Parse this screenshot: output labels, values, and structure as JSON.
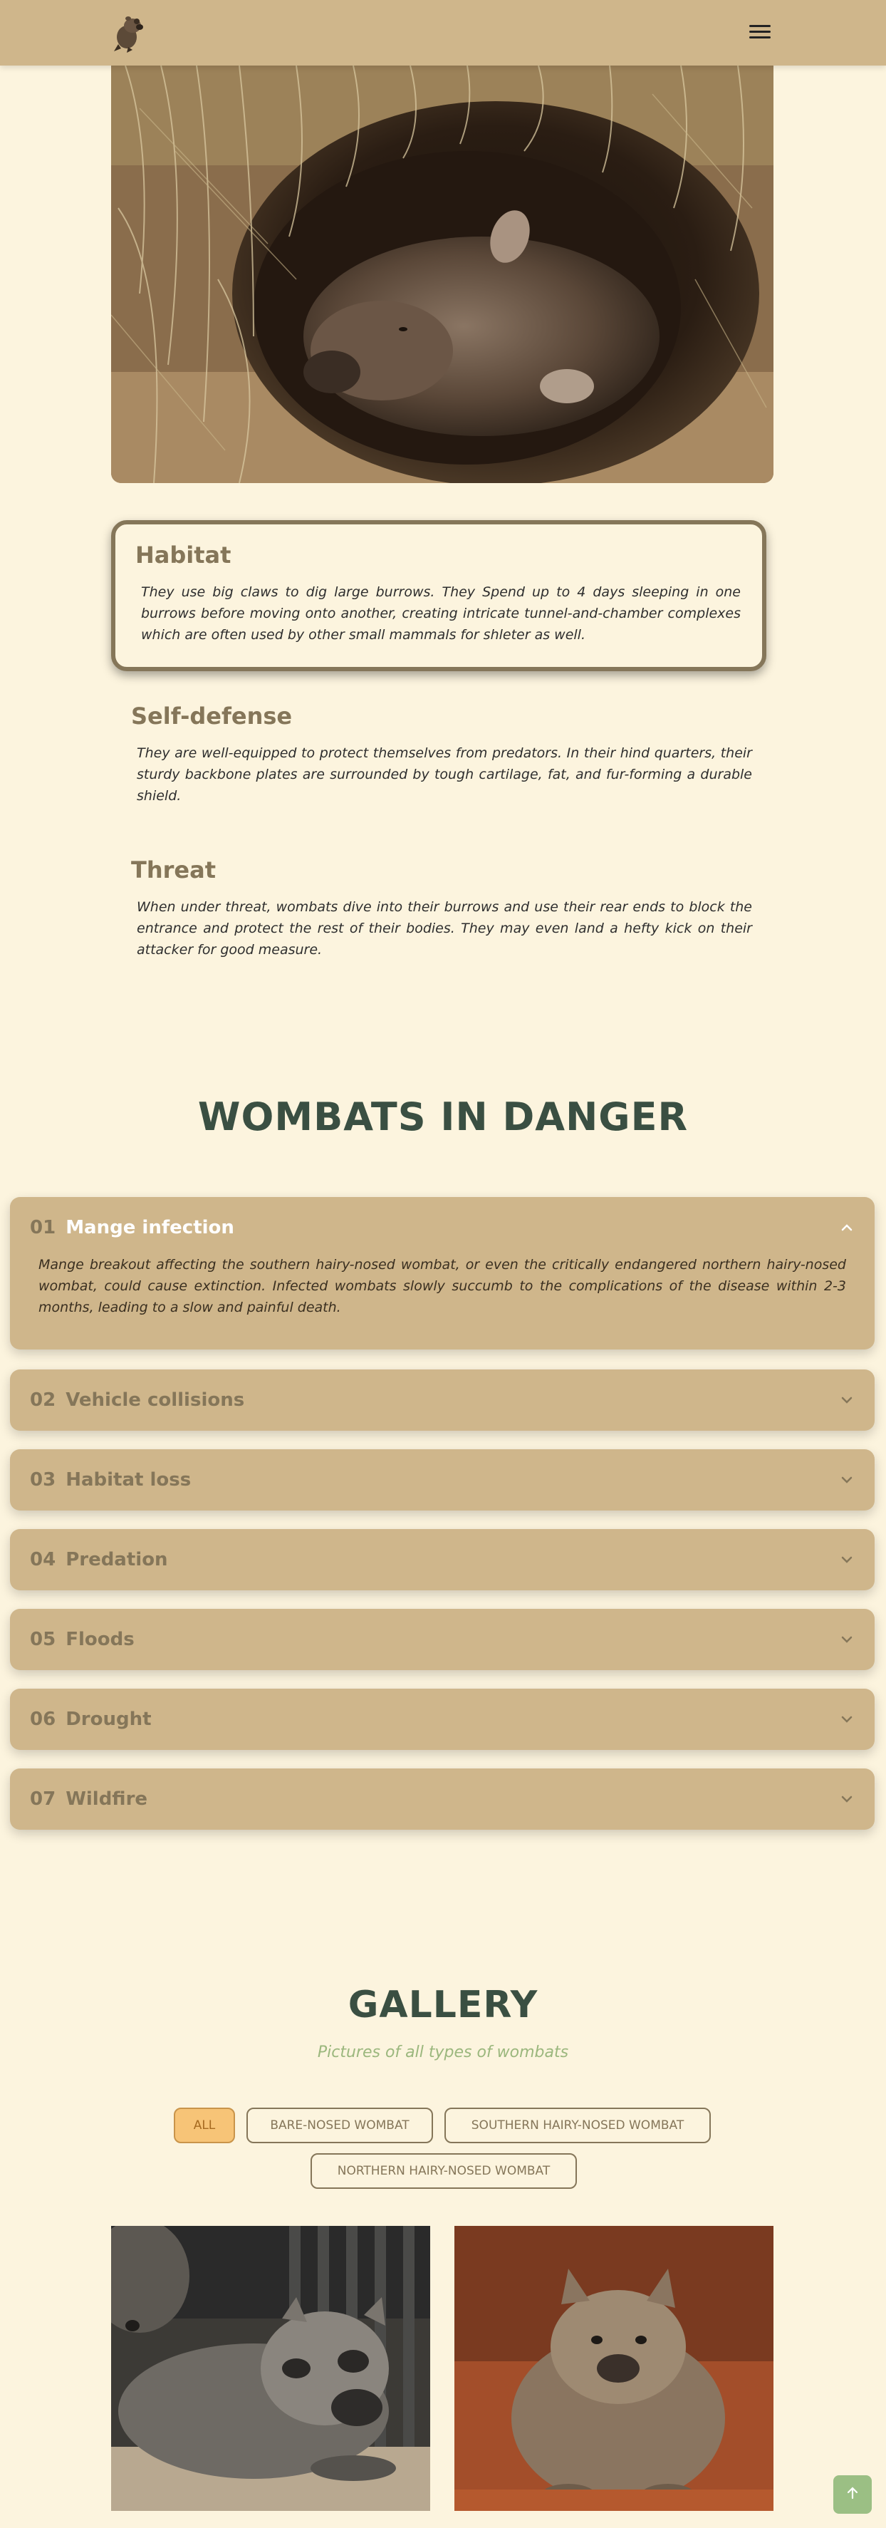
{
  "header": {
    "logo_icon": "wombat-logo-icon",
    "menu_icon": "hamburger-menu-icon"
  },
  "hero": {
    "image": "wombat-in-burrow-photo"
  },
  "facts": [
    {
      "title": "Habitat",
      "text": "They use big claws to dig large burrows. They Spend up to 4 days sleeping in one burrows before moving onto another, creating intricate tunnel-and-chamber complexes which are often used by other small mammals for shleter as well."
    },
    {
      "title": "Self-defense",
      "text": "They are well-equipped to protect themselves from predators. In their hind quarters, their sturdy backbone plates are surrounded by tough cartilage, fat, and fur-forming a durable shield."
    },
    {
      "title": "Threat",
      "text": "When under threat, wombats dive into their burrows and use their rear ends to block the entrance and protect the rest of their bodies. They may even land a hefty kick on their attacker for good measure."
    }
  ],
  "danger": {
    "title": "WOMBATS IN DANGER",
    "items": [
      {
        "num": "01",
        "label": "Mange infection",
        "open": true,
        "text": "Mange breakout affecting the southern hairy-nosed wombat, or even the critically endangered northern hairy-nosed wombat, could cause extinction. Infected wombats slowly succumb to the complications of the disease within 2-3 months, leading to a slow and painful death."
      },
      {
        "num": "02",
        "label": "Vehicle collisions",
        "open": false
      },
      {
        "num": "03",
        "label": "Habitat loss",
        "open": false
      },
      {
        "num": "04",
        "label": "Predation",
        "open": false
      },
      {
        "num": "05",
        "label": "Floods",
        "open": false
      },
      {
        "num": "06",
        "label": "Drought",
        "open": false
      },
      {
        "num": "07",
        "label": "Wildfire",
        "open": false
      }
    ]
  },
  "gallery": {
    "title": "GALLERY",
    "subtitle": "Pictures of all types of wombats",
    "filters": [
      "ALL",
      "BARE-NOSED WOMBAT",
      "SOUTHERN HAIRY-NOSED WOMBAT",
      "NORTHERN HAIRY-NOSED WOMBAT"
    ],
    "active_filter": "ALL",
    "images": [
      "wombat-at-gate-photo",
      "wombat-on-red-sand-photo"
    ]
  },
  "scroll_top_icon": "arrow-up-icon",
  "colors": {
    "background": "#fcf4de",
    "header": "#cfb68b",
    "accent_brown": "#857659",
    "title_green": "#3a4f42",
    "subtitle_green": "#9bb77d",
    "active_filter": "#f7c477"
  }
}
